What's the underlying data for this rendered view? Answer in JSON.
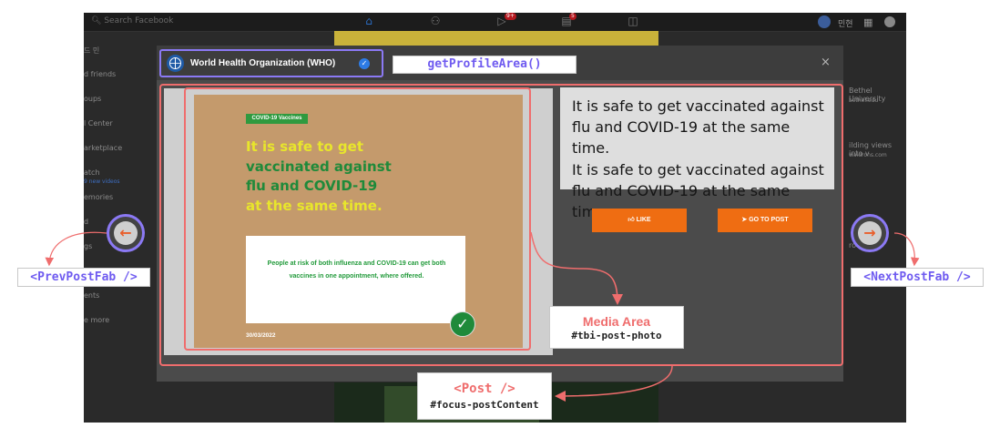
{
  "background": {
    "search_placeholder": "Search Facebook",
    "user_name": "민현",
    "badge_video": "9+",
    "badge_store": "5",
    "sidebar_items": [
      "드 민",
      "d friends",
      "oups",
      "l Center",
      "arketplace",
      "atch",
      "emories",
      "d",
      "gs",
      "",
      "ents",
      "e more"
    ],
    "sidebar_sub_1": "9 new videos",
    "right_items": [
      "Bethel University",
      "bethel.edu",
      "ilding views into v",
      "waldrons.com",
      "roup"
    ]
  },
  "modal": {
    "profile_name": "World Health Organization (WHO)",
    "close_icon": "×"
  },
  "media": {
    "tag": "COVID-19 Vaccines",
    "headline_line1": "It is safe to get",
    "headline_line2": "vaccinated against",
    "headline_line3": "flu and COVID-19",
    "headline_line4": "at the same time.",
    "body_text": "People at risk of both influenza and COVID-19 can get both vaccines in one appointment, where offered.",
    "date": "30/03/2022"
  },
  "post": {
    "text_line1": "It is safe to get vaccinated against",
    "text_line2": "flu and COVID-19 at the same time.",
    "text_line3": "It is safe to get vaccinated against",
    "text_line4": "flu and COVID-19 at the same time.",
    "like_label": "LIKE",
    "goto_label": "GO TO POST"
  },
  "annotations": {
    "profile": "getProfileArea()",
    "media_title": "Media Area",
    "media_id": "#tbi-post-photo",
    "post_title": "<Post />",
    "post_id": "#focus-postContent",
    "prev": "<PrevPostFab />",
    "next": "<NextPostFab />"
  },
  "colors": {
    "annotation_purple": "#6f5bf0",
    "annotation_red": "#ef6d6d",
    "button_orange": "#ef6d12",
    "poster_tan": "#c49a6c",
    "who_green": "#1f8a3a",
    "who_yellow": "#e8e62b"
  }
}
